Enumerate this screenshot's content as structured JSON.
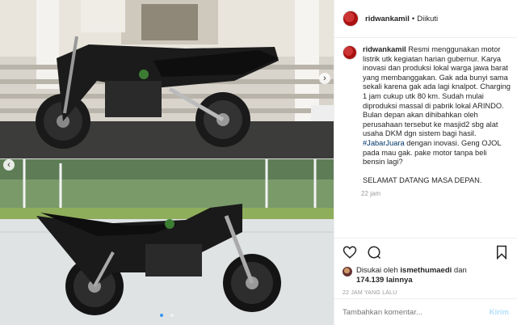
{
  "post": {
    "username": "ridwankamil",
    "separator": "•",
    "follow_status": "Diikuti",
    "caption_lines": [
      "Resmi menggunakan motor listrik utk kegiatan harian gubernur. Karya inovasi dan produksi lokal warga jawa barat yang membanggakan. Gak ada bunyi sama sekali karena gak ada lagi knalpot. Charging 1 jam cukup utk 80 km. Sudah mulai diproduksi massal di pabrik lokal ARINDO.",
      "Bulan depan akan dihibahkan oleh perusahaan tersebut ke masjid2 sbg alat usaha DKM dgn sistem bagi hasil.",
      "#JabarJuara",
      " dengan inovasi. Geng OJOL pada mau gak. pake motor tanpa beli bensin lagi?",
      "SELAMAT DATANG MASA DEPAN."
    ],
    "caption_time": "22 jam",
    "likes_prefix": "Disukai oleh",
    "likes_user": "ismethumaedi",
    "likes_and": "dan",
    "likes_count": "174.139",
    "likes_suffix": "lainnya",
    "time_ago": "22 JAM YANG LALU",
    "comment_placeholder": "Tambahkan komentar...",
    "send_label": "Kirim"
  },
  "carousel": {
    "slides": 2,
    "active": 1
  },
  "colors": {
    "hashtag": "#003569",
    "active_dot": "#3897f0",
    "send_disabled": "#b2dffc"
  }
}
